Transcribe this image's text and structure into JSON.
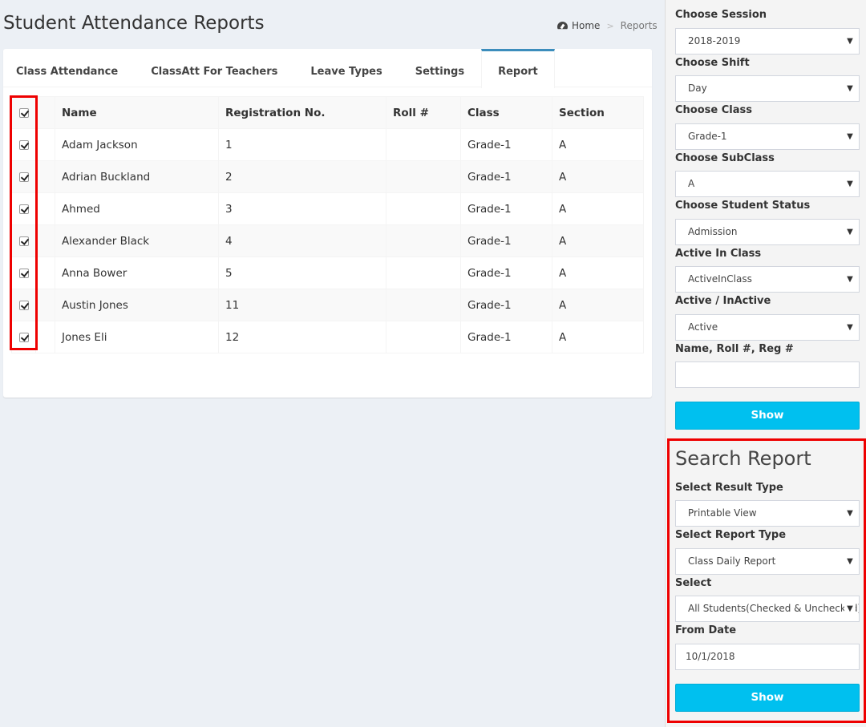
{
  "header": {
    "title": "Student Attendance Reports",
    "breadcrumb": {
      "home": "Home",
      "current": "Reports"
    }
  },
  "tabs": [
    {
      "label": "Class Attendance"
    },
    {
      "label": "ClassAtt For Teachers"
    },
    {
      "label": "Leave Types"
    },
    {
      "label": "Settings"
    },
    {
      "label": "Report"
    }
  ],
  "table": {
    "columns": [
      "Name",
      "Registration No.",
      "Roll #",
      "Class",
      "Section"
    ],
    "rows": [
      {
        "name": "Adam Jackson",
        "reg": "1",
        "roll": "",
        "class": "Grade-1",
        "section": "A"
      },
      {
        "name": "Adrian Buckland",
        "reg": "2",
        "roll": "",
        "class": "Grade-1",
        "section": "A"
      },
      {
        "name": "Ahmed",
        "reg": "3",
        "roll": "",
        "class": "Grade-1",
        "section": "A"
      },
      {
        "name": "Alexander Black",
        "reg": "4",
        "roll": "",
        "class": "Grade-1",
        "section": "A"
      },
      {
        "name": "Anna Bower",
        "reg": "5",
        "roll": "",
        "class": "Grade-1",
        "section": "A"
      },
      {
        "name": "Austin Jones",
        "reg": "11",
        "roll": "",
        "class": "Grade-1",
        "section": "A"
      },
      {
        "name": "Jones Eli",
        "reg": "12",
        "roll": "",
        "class": "Grade-1",
        "section": "A"
      }
    ]
  },
  "filters": {
    "session_label": "Choose Session",
    "session_value": "2018-2019",
    "shift_label": "Choose Shift",
    "shift_value": "Day",
    "class_label": "Choose Class",
    "class_value": "Grade-1",
    "subclass_label": "Choose SubClass",
    "subclass_value": "A",
    "status_label": "Choose Student Status",
    "status_value": "Admission",
    "active_class_label": "Active In Class",
    "active_class_value": "ActiveInClass",
    "active_label": "Active / InActive",
    "active_value": "Active",
    "search_label": "Name, Roll #, Reg #",
    "search_value": "",
    "show_label": "Show"
  },
  "search_report": {
    "title": "Search Report",
    "result_type_label": "Select Result Type",
    "result_type_value": "Printable View",
    "report_type_label": "Select Report Type",
    "report_type_value": "Class Daily Report",
    "select_label": "Select",
    "select_value": "All Students(Checked & Unchecked)",
    "from_date_label": "From Date",
    "from_date_value": "10/1/2018",
    "show_label": "Show"
  },
  "colors": {
    "accent": "#00c0ef",
    "tab_active": "#3c8dbc",
    "highlight": "#e00000"
  }
}
